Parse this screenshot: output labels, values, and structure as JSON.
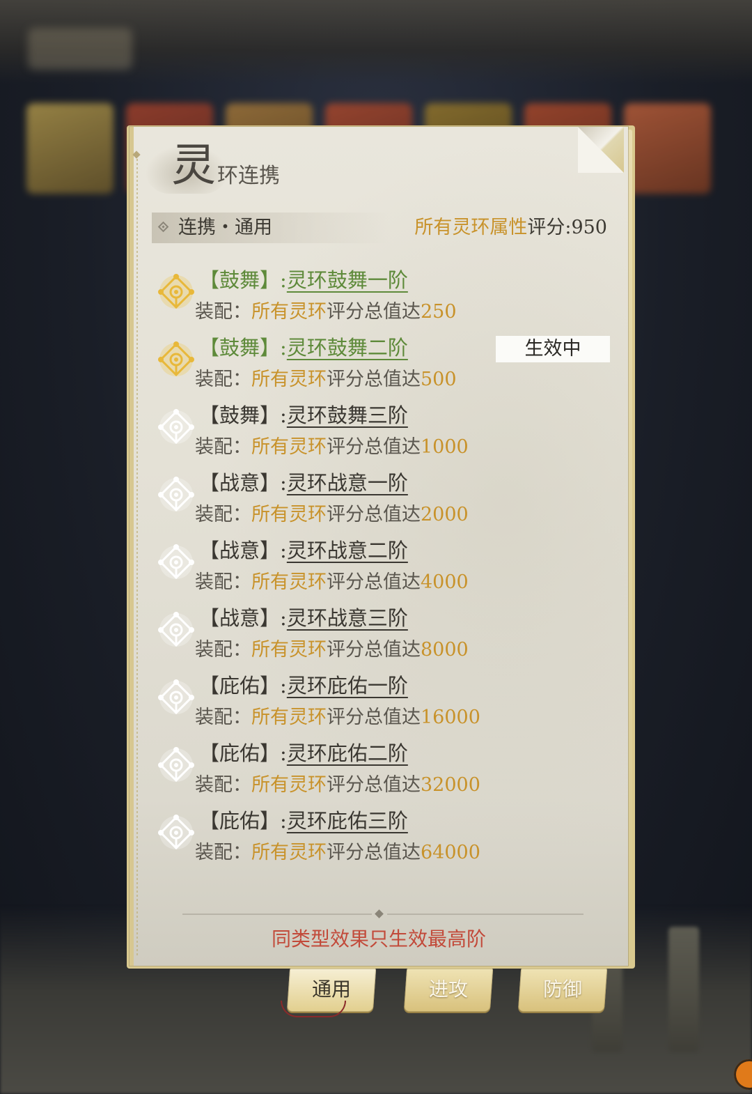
{
  "panel": {
    "title_big": "灵",
    "title_rest": "环连携",
    "header_label": "连携・通用",
    "score_prefix": "所有灵环属性",
    "score_suffix": "评分:950"
  },
  "tiers": [
    {
      "bracket_open": "【",
      "category": "鼓舞",
      "bracket_close": "】",
      "sep": ":",
      "name": "灵环鼓舞一阶",
      "req_label": "装配：",
      "req_a": "所有灵环",
      "req_b": "评分总值达",
      "req_value": "250",
      "state": "active"
    },
    {
      "bracket_open": "【",
      "category": "鼓舞",
      "bracket_close": "】",
      "sep": ":",
      "name": "灵环鼓舞二阶",
      "req_label": "装配：",
      "req_a": "所有灵环",
      "req_b": "评分总值达",
      "req_value": "500",
      "state": "active"
    },
    {
      "bracket_open": "【",
      "category": "鼓舞",
      "bracket_close": "】",
      "sep": ":",
      "name": "灵环鼓舞三阶",
      "req_label": "装配：",
      "req_a": "所有灵环",
      "req_b": "评分总值达",
      "req_value": "1000",
      "state": "inactive"
    },
    {
      "bracket_open": "【",
      "category": "战意",
      "bracket_close": "】",
      "sep": ":",
      "name": "灵环战意一阶",
      "req_label": "装配：",
      "req_a": "所有灵环",
      "req_b": "评分总值达",
      "req_value": "2000",
      "state": "inactive"
    },
    {
      "bracket_open": "【",
      "category": "战意",
      "bracket_close": "】",
      "sep": ":",
      "name": "灵环战意二阶",
      "req_label": "装配：",
      "req_a": "所有灵环",
      "req_b": "评分总值达",
      "req_value": "4000",
      "state": "inactive"
    },
    {
      "bracket_open": "【",
      "category": "战意",
      "bracket_close": "】",
      "sep": ":",
      "name": "灵环战意三阶",
      "req_label": "装配：",
      "req_a": "所有灵环",
      "req_b": "评分总值达",
      "req_value": "8000",
      "state": "inactive"
    },
    {
      "bracket_open": "【",
      "category": "庇佑",
      "bracket_close": "】",
      "sep": ":",
      "name": "灵环庇佑一阶",
      "req_label": "装配：",
      "req_a": "所有灵环",
      "req_b": "评分总值达",
      "req_value": "16000",
      "state": "inactive"
    },
    {
      "bracket_open": "【",
      "category": "庇佑",
      "bracket_close": "】",
      "sep": ":",
      "name": "灵环庇佑二阶",
      "req_label": "装配：",
      "req_a": "所有灵环",
      "req_b": "评分总值达",
      "req_value": "32000",
      "state": "inactive"
    },
    {
      "bracket_open": "【",
      "category": "庇佑",
      "bracket_close": "】",
      "sep": ":",
      "name": "灵环庇佑三阶",
      "req_label": "装配：",
      "req_a": "所有灵环",
      "req_b": "评分总值达",
      "req_value": "64000",
      "state": "inactive"
    }
  ],
  "status_badge": "生效中",
  "footer_note": "同类型效果只生效最高阶",
  "tabs": [
    {
      "label": "通用",
      "selected": true
    },
    {
      "label": "进攻",
      "selected": false
    },
    {
      "label": "防御",
      "selected": false
    }
  ],
  "colors": {
    "active_name": "#5e8a3a",
    "gold": "#c8922a",
    "footer_red": "#c24a3a",
    "icon_active": "#e8b83a",
    "icon_inactive": "#ffffff"
  }
}
